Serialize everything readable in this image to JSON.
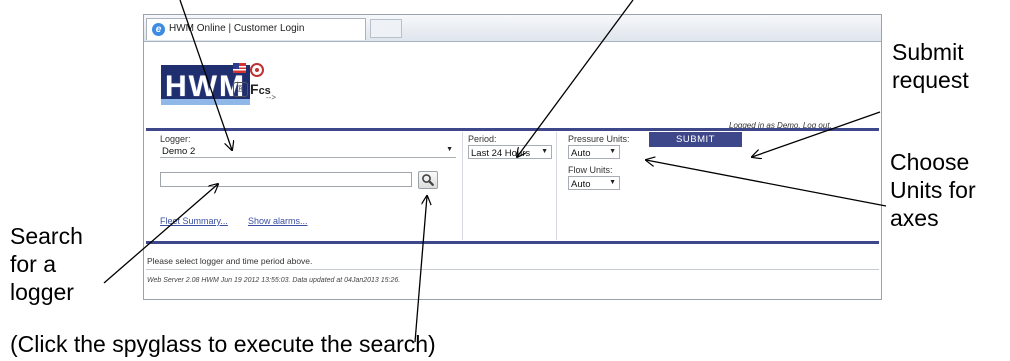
{
  "browser": {
    "tab_title": "HWM Online | Customer Login"
  },
  "logo": {
    "text": "HWM"
  },
  "account": {
    "logged_in_text": "Logged in as Demo.",
    "logout_label": "Log out."
  },
  "form": {
    "logger_label": "Logger:",
    "logger_value": "Demo 2",
    "search_placeholder": "",
    "fleet_summary_link": "Fleet Summary...",
    "show_alarms_link": "Show alarms...",
    "period_label": "Period:",
    "period_value": "Last 24 Hours",
    "pressure_units_label": "Pressure Units:",
    "pressure_units_value": "Auto",
    "flow_units_label": "Flow Units:",
    "flow_units_value": "Auto",
    "submit_label": "SUBMIT"
  },
  "status": {
    "message": "Please select logger and time period above.",
    "footer": "Web Server 2.08 HWM Jun 19 2012 13:55:03. Data updated at 04Jan2013 15:26."
  },
  "annotations": {
    "submit_line1": "Submit",
    "submit_line2": "request",
    "units_line1": "Choose",
    "units_line2": "Units for",
    "units_line3": "axes",
    "search_line1": "Search",
    "search_line2": "for a",
    "search_line3": "logger",
    "spyglass": "(Click the spyglass to execute the search)"
  },
  "colors": {
    "brand_navy": "#3e4789",
    "link": "#3a4fa0"
  },
  "icons": {
    "browser": "ie-icon",
    "search": "magnifier-icon"
  }
}
